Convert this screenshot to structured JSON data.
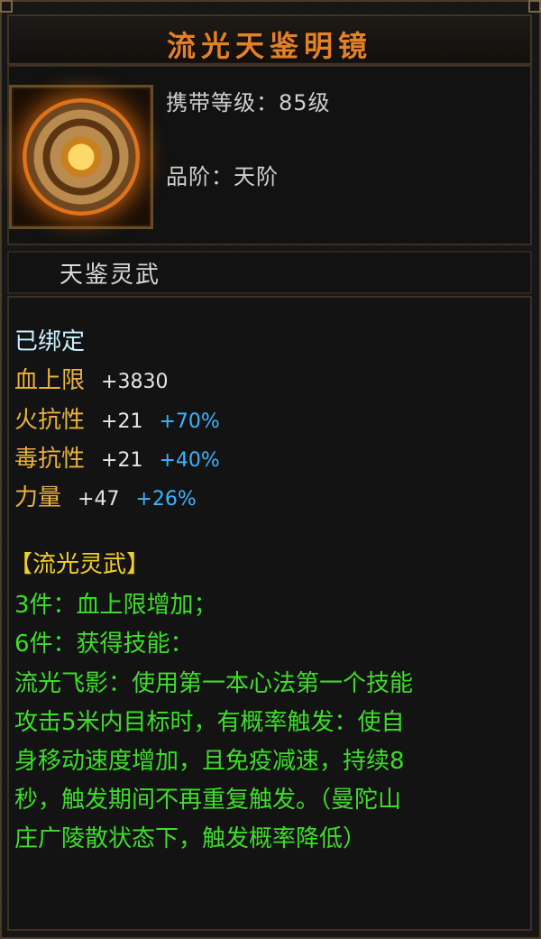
{
  "item": {
    "name": "流光天鉴明镜",
    "icon": "bronze-mirror-icon",
    "carry_level_label": "携带等级：",
    "carry_level_value": "85级",
    "grade_label": "品阶：",
    "grade_value": "天阶",
    "type": "天鉴灵武",
    "bound_status": "已绑定",
    "stats": [
      {
        "name": "血上限",
        "value": "+3830",
        "pct": ""
      },
      {
        "name": "火抗性",
        "value": "+21",
        "pct": "+70%"
      },
      {
        "name": "毒抗性",
        "value": "+21",
        "pct": "+40%"
      },
      {
        "name": "力量",
        "value": "+47",
        "pct": "+26%"
      }
    ],
    "set": {
      "title": "【流光灵武】",
      "piece3": "3件：血上限增加；",
      "piece6": "6件：获得技能：",
      "skill_lines": [
        "流光飞影：使用第一本心法第一个技能",
        "攻击5米内目标时，有概率触发：使自",
        "身移动速度增加，且免疫减速，持续8",
        "秒，触发期间不再重复触发。（曼陀山",
        "庄广陵散状态下，触发概率降低）"
      ]
    }
  },
  "colors": {
    "title": "#e08228",
    "bound": "#c8f0ff",
    "stat_name": "#e9b33a",
    "percent": "#38b4ff",
    "set_title": "#f0d020",
    "set_text": "#3cde27"
  }
}
